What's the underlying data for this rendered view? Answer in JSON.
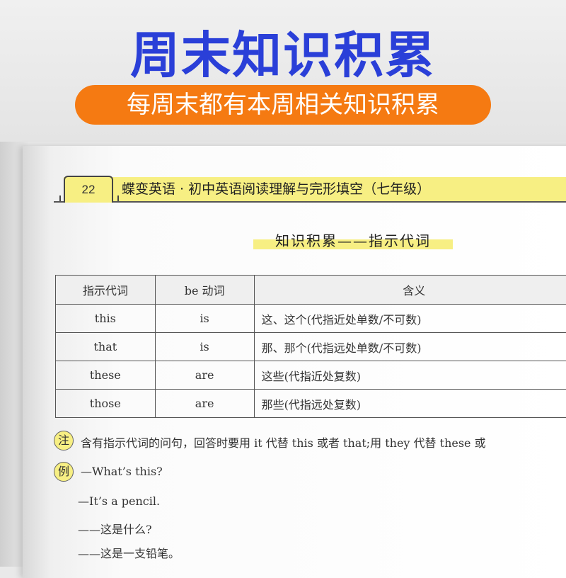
{
  "banner": {
    "title": "周末知识积累",
    "subtitle": "每周末都有本周相关知识积累",
    "title_color": "#2a3fd8",
    "pill_color": "#f57a12"
  },
  "page": {
    "page_number": "22",
    "book_title": "蝶变英语 · 初中英语阅读理解与完形填空（七年级）",
    "section_title": "知识积累——指示代词",
    "highlight_color": "#f7ef83"
  },
  "table": {
    "headers": [
      "指示代词",
      "be 动词",
      "含义"
    ],
    "rows": [
      [
        "this",
        "is",
        "这、这个(代指近处单数/不可数)"
      ],
      [
        "that",
        "is",
        "那、那个(代指远处单数/不可数)"
      ],
      [
        "these",
        "are",
        "这些(代指近处复数)"
      ],
      [
        "those",
        "are",
        "那些(代指远处复数)"
      ]
    ]
  },
  "note": {
    "mark": "注",
    "text": "含有指示代词的问句，回答时要用 it 代替 this 或者 that;用 they 代替 these 或"
  },
  "example": {
    "mark": "例",
    "lines": [
      "—What’s this?",
      "—It’s a pencil.",
      "——这是什么?",
      "——这是一支铅笔。"
    ]
  }
}
